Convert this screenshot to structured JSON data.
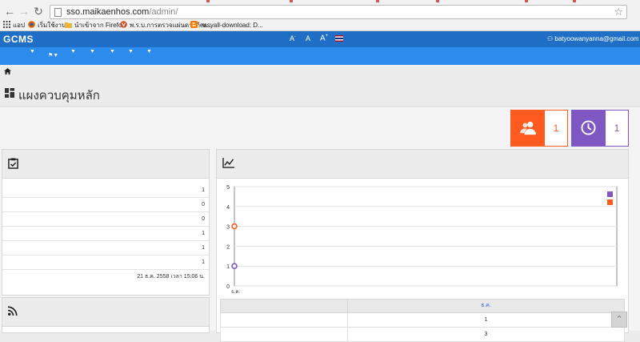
{
  "browser": {
    "url_host": "sso.maikaenhos.com",
    "url_path": "/admin/",
    "bookmarks": [
      {
        "label": "แอป",
        "icon": "apps-icon",
        "color": "#4a4a4a"
      },
      {
        "label": "เริ่มใช้งาน",
        "icon": "firefox-icon",
        "color": "#e66000"
      },
      {
        "label": "นำเข้าจาก Firefox",
        "icon": "folder-icon",
        "color": "#e8b53a"
      },
      {
        "label": "พ.ร.บ.การตรวจแผ่นดาวกิ ข...",
        "icon": "v-icon",
        "color": "#d64a1e"
      },
      {
        "label": "easyall-download: D...",
        "icon": "blogger-icon",
        "color": "#f57d00"
      }
    ]
  },
  "app": {
    "logo": "GCMS",
    "font_small": "A",
    "font_normal": "A",
    "font_large": "A",
    "user_email": "batyoowanyanna@gmail.com",
    "brand_color": "#1f6fc6",
    "menu_color": "#2b8ced"
  },
  "page": {
    "title": "แผงควบคุมหลัก"
  },
  "stats": [
    {
      "name": "members",
      "icon": "users-icon",
      "value": "1",
      "color": "#ff5a1f"
    },
    {
      "name": "online",
      "icon": "clock-icon",
      "value": "1",
      "color": "#7e57c2"
    }
  ],
  "tasks_panel": {
    "icon": "clipboard-check-icon",
    "rows": [
      "1",
      "0",
      "0",
      "1",
      "1",
      "1",
      "21 ธ.ค. 2558 เวลา 15:06 น."
    ]
  },
  "chart_panel": {
    "icon": "line-chart-icon"
  },
  "chart_data": {
    "type": "line",
    "categories": [
      "ธ.ค."
    ],
    "series": [
      {
        "values": [
          1
        ],
        "color": "#7e57c2"
      },
      {
        "values": [
          3
        ],
        "color": "#ff5a1f"
      }
    ],
    "ylim": [
      0,
      5
    ],
    "yticks": [
      "0",
      "1",
      "2",
      "3",
      "4",
      "5"
    ],
    "grid": true,
    "legend": "top-right"
  },
  "chart_table": {
    "header": [
      "",
      "ธ.ค."
    ],
    "rows": [
      [
        "",
        "1"
      ],
      [
        "",
        "3"
      ]
    ]
  },
  "feed_panel": {
    "icon": "rss-icon"
  }
}
